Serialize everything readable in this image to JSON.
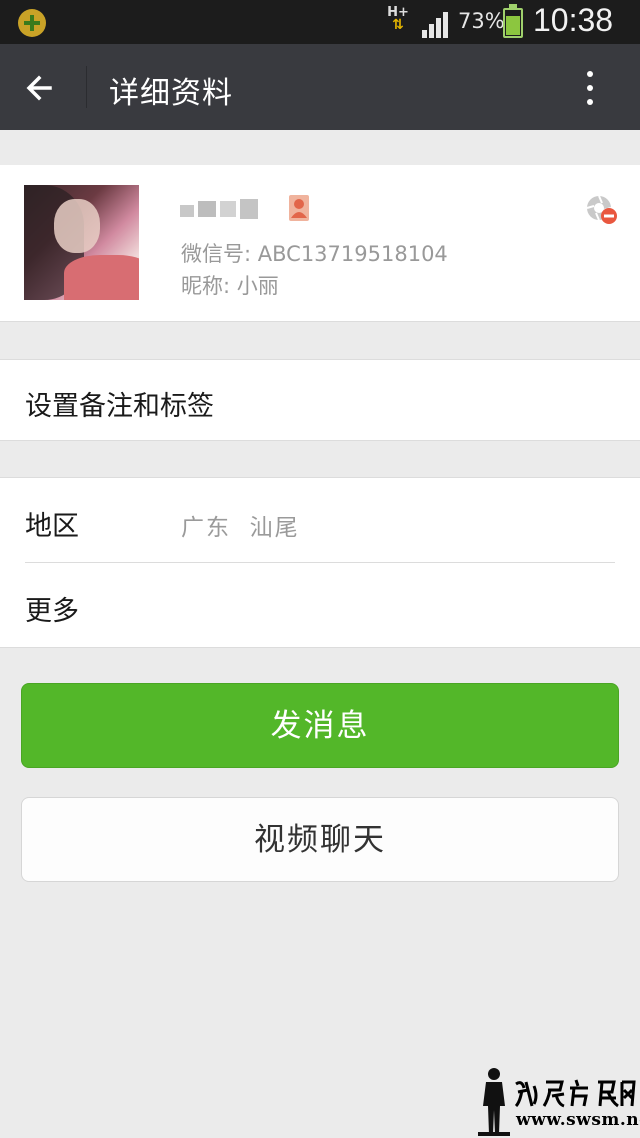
{
  "status_bar": {
    "network_type": "H+",
    "signal_icon": "signal-icon",
    "battery_percent": "73%",
    "battery_level": 0.73,
    "time": "10:38"
  },
  "header": {
    "title": "详细资料",
    "back_icon": "back-arrow-icon",
    "more_icon": "more-vertical-icon"
  },
  "profile": {
    "wechat_id": "微信号: ABC13719518104",
    "nickname": "昵称: 小丽"
  },
  "rows": {
    "remark_label": "设置备注和标签",
    "region_label": "地区",
    "region_value": "广东  汕尾",
    "more_label": "更多"
  },
  "actions": {
    "send_message": "发消息",
    "video_chat": "视频聊天"
  },
  "watermark": {
    "url": "www.swsm.net"
  },
  "colors": {
    "title_bar": "#393a3f",
    "primary": "#53b729",
    "background": "#ebebeb"
  }
}
